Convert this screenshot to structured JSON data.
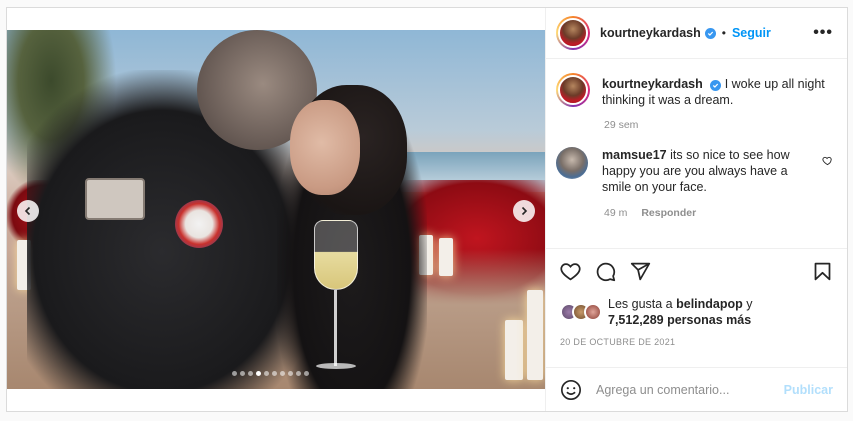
{
  "post": {
    "username": "kourtneykardash",
    "follow_label": "Seguir",
    "more_label": "•••",
    "dot_separator": "•"
  },
  "caption": {
    "username": "kourtneykardash",
    "text": "I woke up all night thinking it was a dream.",
    "time": "29 sem"
  },
  "comments": [
    {
      "username": "mamsue17",
      "text": "its so nice to see how happy you are you always have a smile on your face.",
      "time": "49 m",
      "reply_label": "Responder"
    }
  ],
  "likes": {
    "prefix": "Les gusta a",
    "user": "belindapop",
    "connector": "y",
    "count": "7,512,289 personas más"
  },
  "date": "20 DE OCTUBRE DE 2021",
  "add_comment": {
    "placeholder": "Agrega un comentario...",
    "post_label": "Publicar"
  },
  "carousel": {
    "total_slides": 10,
    "active_index": 3
  },
  "colors": {
    "accent": "#0095f6",
    "verified": "#3897f0",
    "muted": "#8e8e8e",
    "post_disabled": "#b2dffc"
  },
  "icons": [
    "chevron-left-icon",
    "chevron-right-icon",
    "verified-icon",
    "more-icon",
    "heart-icon",
    "comment-icon",
    "share-icon",
    "save-icon",
    "emoji-icon"
  ]
}
